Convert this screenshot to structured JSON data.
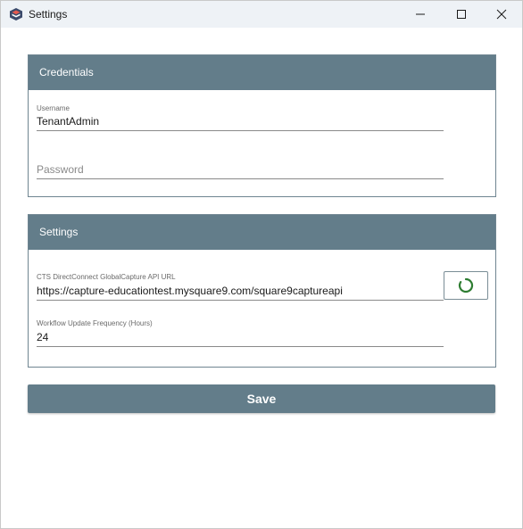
{
  "window": {
    "title": "Settings",
    "icons": {
      "app": "app-logo-icon",
      "minimize": "minimize-icon",
      "maximize": "maximize-icon",
      "close": "close-icon"
    }
  },
  "credentials": {
    "header": "Credentials",
    "username": {
      "label": "Username",
      "value": "TenantAdmin"
    },
    "password": {
      "placeholder": "Password",
      "value": ""
    }
  },
  "settings": {
    "header": "Settings",
    "api_url": {
      "label": "CTS DirectConnect GlobalCapture API URL",
      "value": "https://capture-educationtest.mysquare9.com/square9captureapi"
    },
    "test_button_icon": "refresh-circle-icon",
    "frequency": {
      "label": "Workflow Update Frequency (Hours)",
      "value": "24"
    }
  },
  "save_label": "Save",
  "colors": {
    "accent": "#637d8a",
    "status_ring": "#2e7d32"
  }
}
